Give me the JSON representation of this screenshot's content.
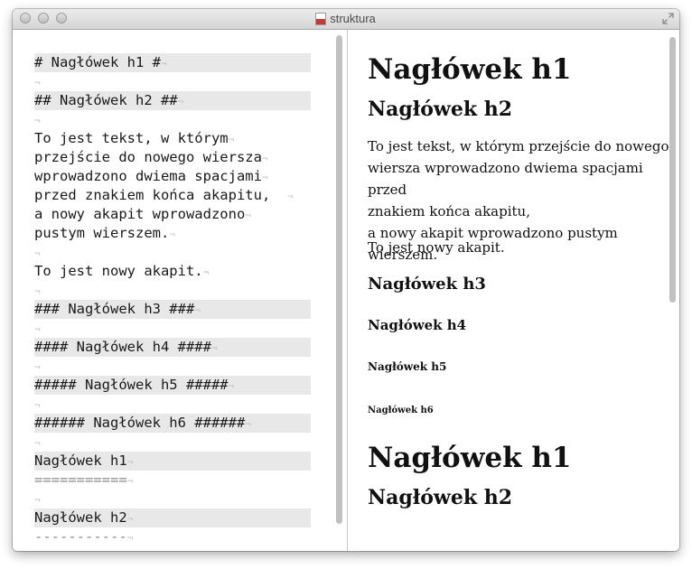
{
  "window": {
    "title": "struktura"
  },
  "editor": {
    "lines": [
      {
        "text": "# Nagłówek h1 #",
        "hl": true
      },
      {
        "text": "",
        "hl": false
      },
      {
        "text": "## Nagłówek h2 ##",
        "hl": true
      },
      {
        "text": "",
        "hl": false
      },
      {
        "text": "To jest tekst, w którym",
        "hl": false
      },
      {
        "text": "przejście do nowego wiersza",
        "hl": false
      },
      {
        "text": "wprowadzono dwiema spacjami",
        "hl": false
      },
      {
        "text": "przed znakiem końca akapitu,  ",
        "hl": false
      },
      {
        "text": "a nowy akapit wprowadzono",
        "hl": false
      },
      {
        "text": "pustym wierszem.",
        "hl": false
      },
      {
        "text": "",
        "hl": false
      },
      {
        "text": "To jest nowy akapit.",
        "hl": false
      },
      {
        "text": "",
        "hl": false
      },
      {
        "text": "### Nagłówek h3 ###",
        "hl": true
      },
      {
        "text": "",
        "hl": false
      },
      {
        "text": "#### Nagłówek h4 ####",
        "hl": true
      },
      {
        "text": "",
        "hl": false
      },
      {
        "text": "##### Nagłówek h5 #####",
        "hl": true
      },
      {
        "text": "",
        "hl": false
      },
      {
        "text": "###### Nagłówek h6 ######",
        "hl": true
      },
      {
        "text": "",
        "hl": false
      },
      {
        "text": "Nagłówek h1",
        "hl": true
      },
      {
        "text": "===========",
        "hl": false,
        "mark": true
      },
      {
        "text": "",
        "hl": false
      },
      {
        "text": "Nagłówek h2",
        "hl": true
      },
      {
        "text": "-----------",
        "hl": false,
        "mark": true
      }
    ]
  },
  "preview": {
    "h1_a": "Nagłówek h1",
    "h2_a": "Nagłówek h2",
    "p1_line1": "To jest tekst, w którym przejście do nowego",
    "p1_line2": "wiersza wprowadzono dwiema spacjami przed",
    "p1_line3": "znakiem końca akapitu,",
    "p1_line4": "a nowy akapit wprowadzono pustym wierszem.",
    "p2": "To jest nowy akapit.",
    "h3": "Nagłówek h3",
    "h4": "Nagłówek h4",
    "h5": "Nagłówek h5",
    "h6": "Nagłówek h6",
    "h1_b": "Nagłówek h1",
    "h2_b": "Nagłówek h2"
  }
}
